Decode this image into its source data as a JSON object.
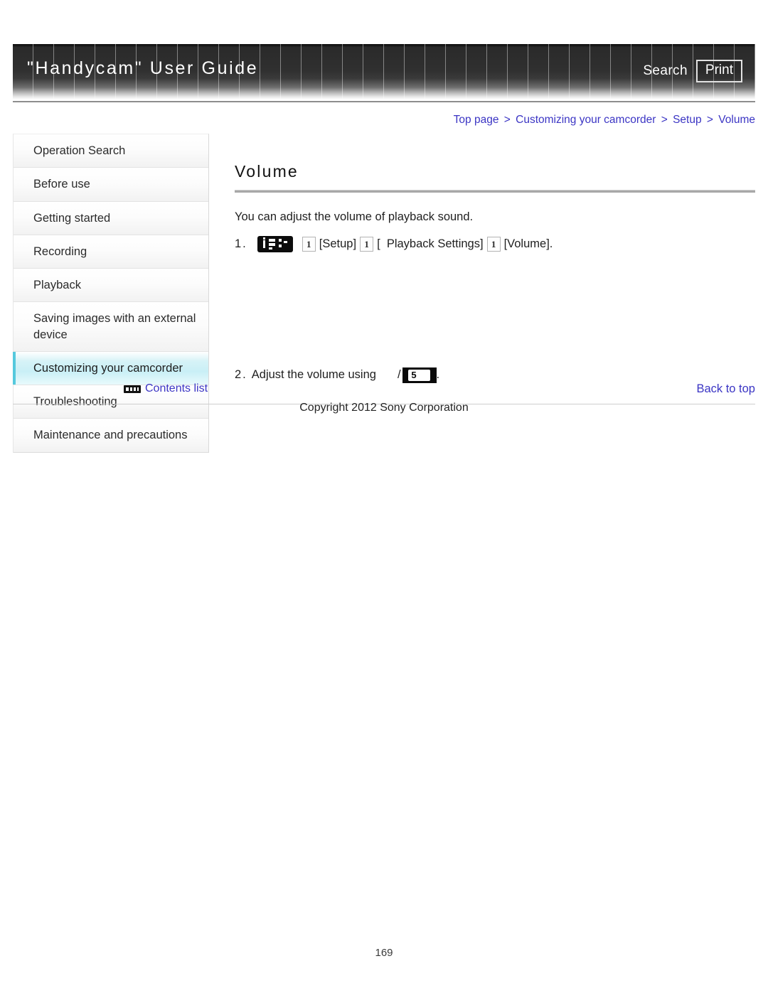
{
  "header": {
    "title": "\"Handycam\" User Guide",
    "search_label": "Search",
    "print_label": "Print"
  },
  "breadcrumb": {
    "items": [
      "Top page",
      "Customizing your camcorder",
      "Setup",
      "Volume"
    ],
    "separator": ">"
  },
  "sidebar": {
    "items": [
      {
        "label": "Operation Search",
        "active": false
      },
      {
        "label": "Before use",
        "active": false
      },
      {
        "label": "Getting started",
        "active": false
      },
      {
        "label": "Recording",
        "active": false
      },
      {
        "label": "Playback",
        "active": false
      },
      {
        "label": "Saving images with an external device",
        "active": false
      },
      {
        "label": "Customizing your camcorder",
        "active": true
      },
      {
        "label": "Troubleshooting",
        "active": false
      },
      {
        "label": "Maintenance and precautions",
        "active": false
      }
    ]
  },
  "main": {
    "title": "Volume",
    "intro": "You can adjust the volume of playback sound.",
    "steps": [
      {
        "number": "1.",
        "icon": "menu-icon",
        "parts": [
          "[Setup]",
          "[",
          "  Playback Settings]",
          "[Volume]."
        ]
      },
      {
        "number": "2.",
        "text": "Adjust the volume using",
        "slash": "/",
        "icon": "volume-control-icon",
        "trailing": "."
      }
    ]
  },
  "footer": {
    "contents_list_label": "Contents list",
    "back_to_top_label": "Back to top",
    "copyright": "Copyright 2012 Sony Corporation",
    "page_number": "169"
  },
  "colors": {
    "link": "#3b35c4",
    "sidebar_active": "#c9eff6",
    "header_dark": "#0b0b0b"
  }
}
